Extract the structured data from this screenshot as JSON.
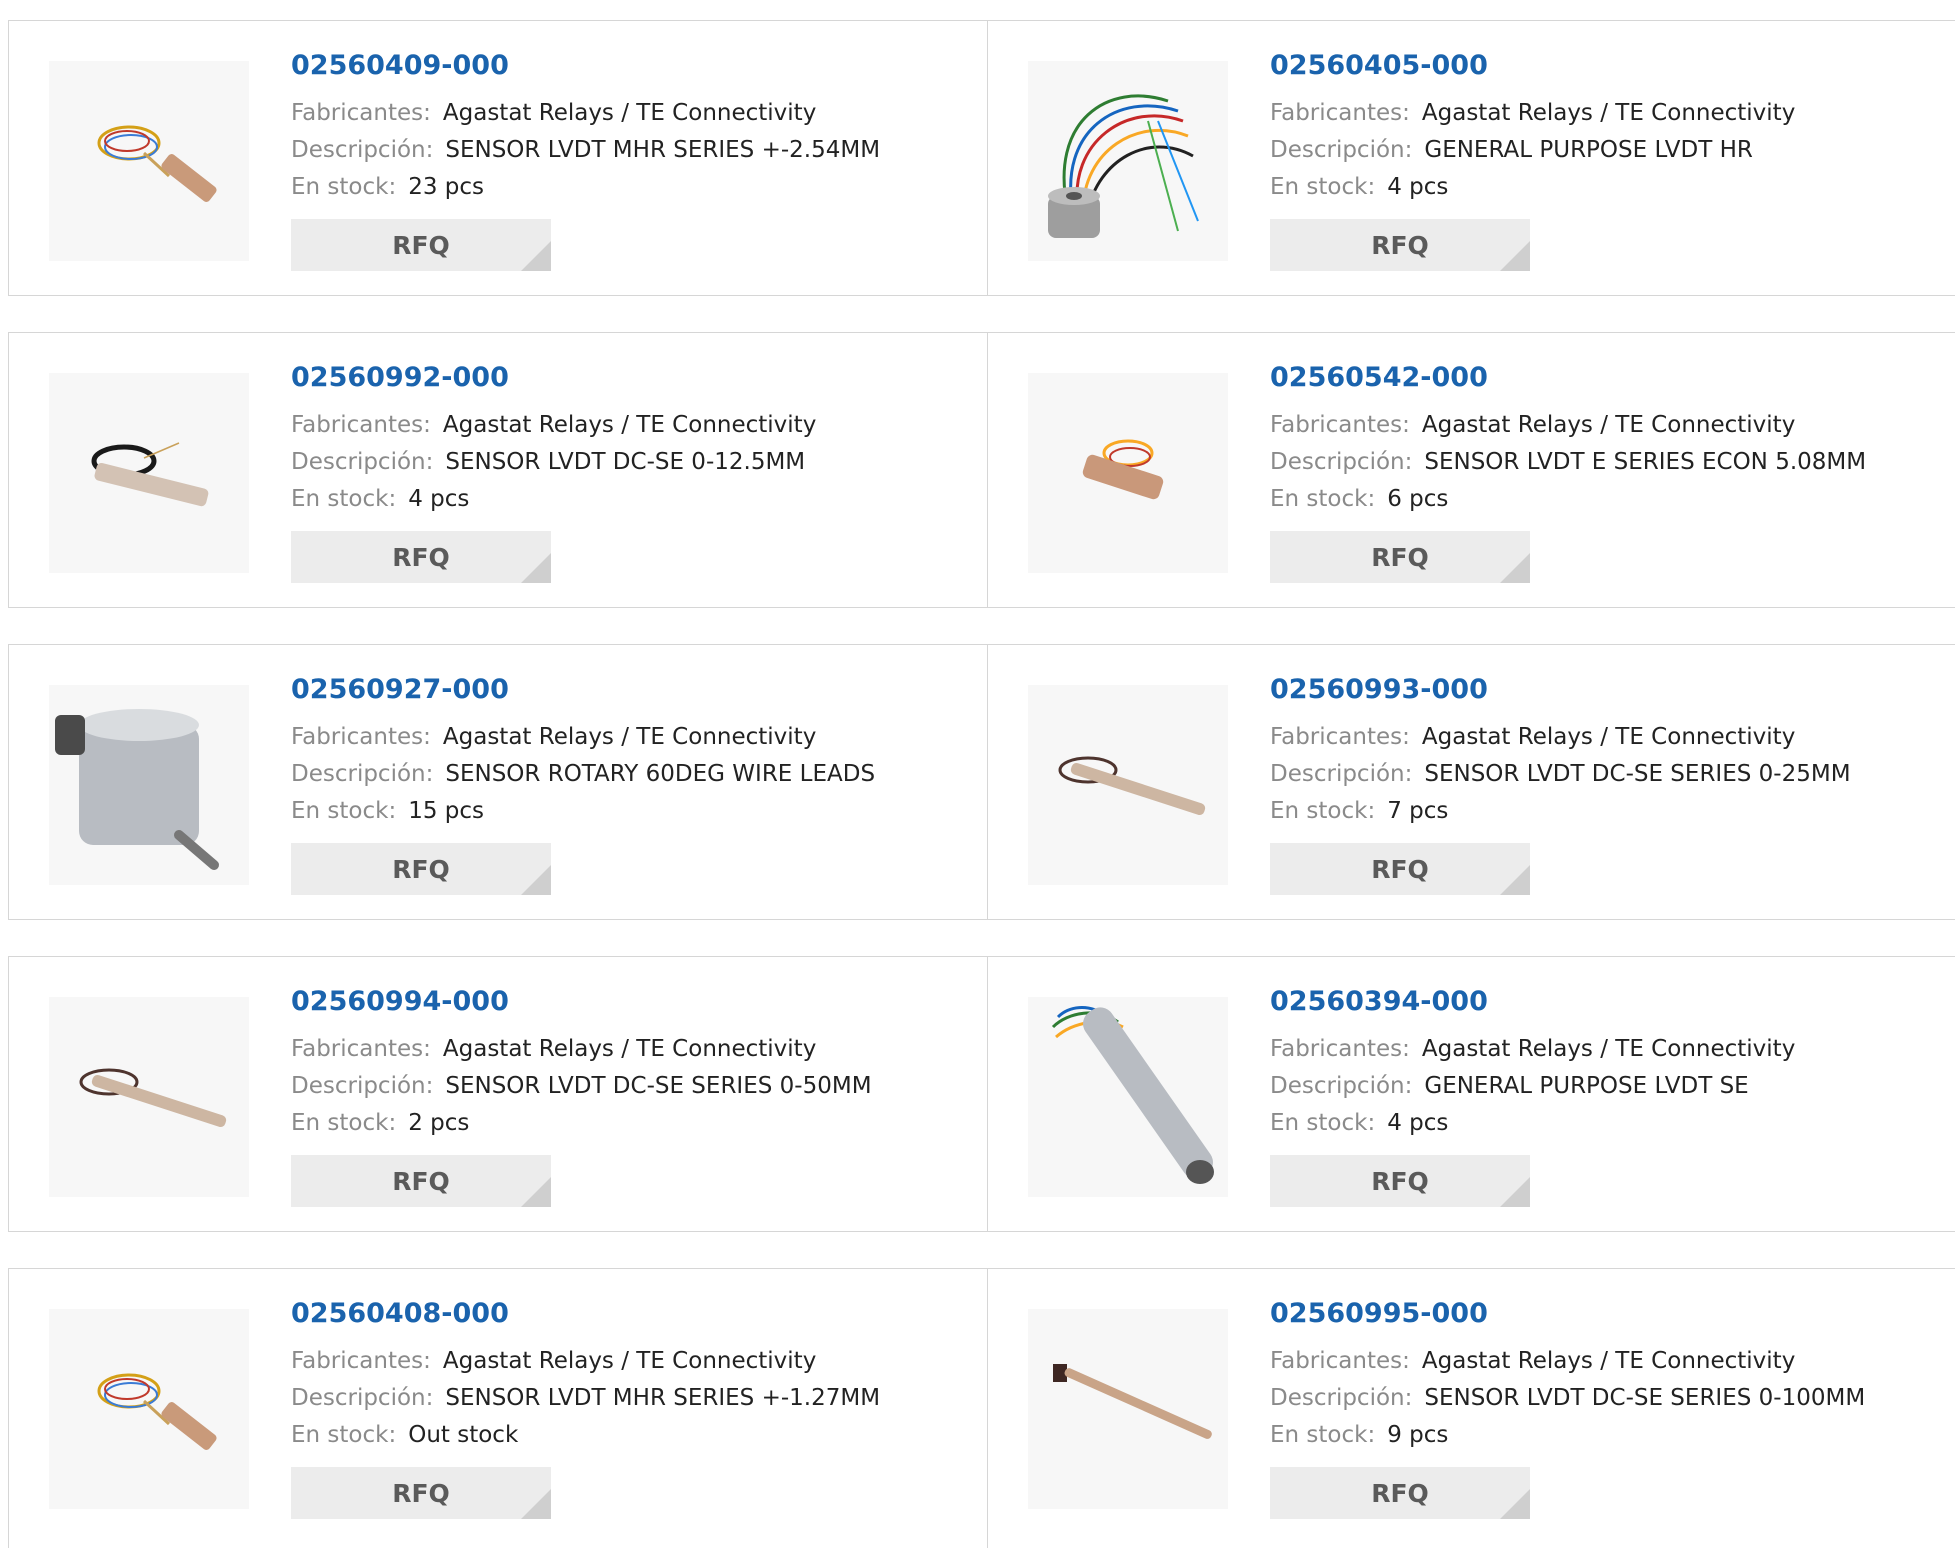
{
  "labels": {
    "manufacturer": "Fabricantes:",
    "description": "Descripción:",
    "stock": "En stock:",
    "rfq": "RFQ"
  },
  "colors": {
    "link": "#1a63ad",
    "button_bg": "#ececec",
    "button_text": "#5a5a5a"
  },
  "products": [
    {
      "part": "02560409-000",
      "manufacturer": "Agastat Relays / TE Connectivity",
      "description": "SENSOR LVDT MHR SERIES +-2.54MM",
      "stock": "23 pcs",
      "image": "small-lvdt-coiled-wires-icon"
    },
    {
      "part": "02560405-000",
      "manufacturer": "Agastat Relays / TE Connectivity",
      "description": "GENERAL PURPOSE LVDT HR",
      "stock": "4 pcs",
      "image": "ring-lvdt-long-wires-icon"
    },
    {
      "part": "02560992-000",
      "manufacturer": "Agastat Relays / TE Connectivity",
      "description": "SENSOR LVDT DC-SE 0-12.5MM",
      "stock": "4 pcs",
      "image": "lvdt-black-cable-icon"
    },
    {
      "part": "02560542-000",
      "manufacturer": "Agastat Relays / TE Connectivity",
      "description": "SENSOR LVDT E SERIES ECON 5.08MM",
      "stock": "6 pcs",
      "image": "short-lvdt-coiled-wires-icon"
    },
    {
      "part": "02560927-000",
      "manufacturer": "Agastat Relays / TE Connectivity",
      "description": "SENSOR ROTARY 60DEG WIRE LEADS",
      "stock": "15 pcs",
      "image": "rotary-sensor-cylinder-icon"
    },
    {
      "part": "02560993-000",
      "manufacturer": "Agastat Relays / TE Connectivity",
      "description": "SENSOR LVDT DC-SE SERIES 0-25MM",
      "stock": "7 pcs",
      "image": "long-lvdt-brown-cable-icon"
    },
    {
      "part": "02560994-000",
      "manufacturer": "Agastat Relays / TE Connectivity",
      "description": "SENSOR LVDT DC-SE SERIES 0-50MM",
      "stock": "2 pcs",
      "image": "long-lvdt-brown-cable-icon"
    },
    {
      "part": "02560394-000",
      "manufacturer": "Agastat Relays / TE Connectivity",
      "description": "GENERAL PURPOSE LVDT SE",
      "stock": "4 pcs",
      "image": "large-lvdt-tube-icon"
    },
    {
      "part": "02560408-000",
      "manufacturer": "Agastat Relays / TE Connectivity",
      "description": "SENSOR LVDT MHR SERIES +-1.27MM",
      "stock": "Out stock",
      "image": "small-lvdt-coiled-wires-icon"
    },
    {
      "part": "02560995-000",
      "manufacturer": "Agastat Relays / TE Connectivity",
      "description": "SENSOR LVDT DC-SE SERIES 0-100MM",
      "stock": "9 pcs",
      "image": "thin-long-lvdt-icon"
    }
  ]
}
